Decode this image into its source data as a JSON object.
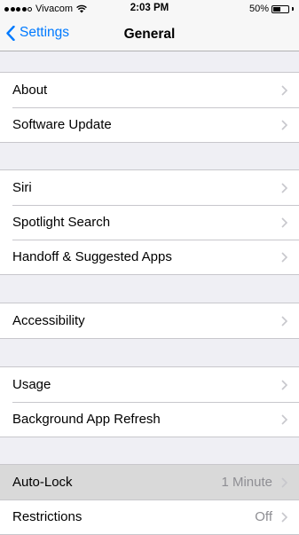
{
  "status_bar": {
    "carrier": "Vivacom",
    "time": "2:03 PM",
    "battery_percent": "50%",
    "battery_level": 0.5,
    "signal_bars": 4,
    "signal_max": 5
  },
  "nav": {
    "back_label": "Settings",
    "title": "General"
  },
  "groups": [
    {
      "rows": [
        {
          "label": "About",
          "value": ""
        },
        {
          "label": "Software Update",
          "value": ""
        }
      ]
    },
    {
      "rows": [
        {
          "label": "Siri",
          "value": ""
        },
        {
          "label": "Spotlight Search",
          "value": ""
        },
        {
          "label": "Handoff & Suggested Apps",
          "value": ""
        }
      ]
    },
    {
      "rows": [
        {
          "label": "Accessibility",
          "value": ""
        }
      ]
    },
    {
      "rows": [
        {
          "label": "Usage",
          "value": ""
        },
        {
          "label": "Background App Refresh",
          "value": ""
        }
      ]
    },
    {
      "rows": [
        {
          "label": "Auto-Lock",
          "value": "1 Minute",
          "highlighted": true
        },
        {
          "label": "Restrictions",
          "value": "Off"
        }
      ]
    }
  ],
  "colors": {
    "accent": "#007aff",
    "background": "#efeff4",
    "value_text": "#8e8e93",
    "chevron": "#c7c7cc",
    "highlight": "#d9d9d9"
  }
}
